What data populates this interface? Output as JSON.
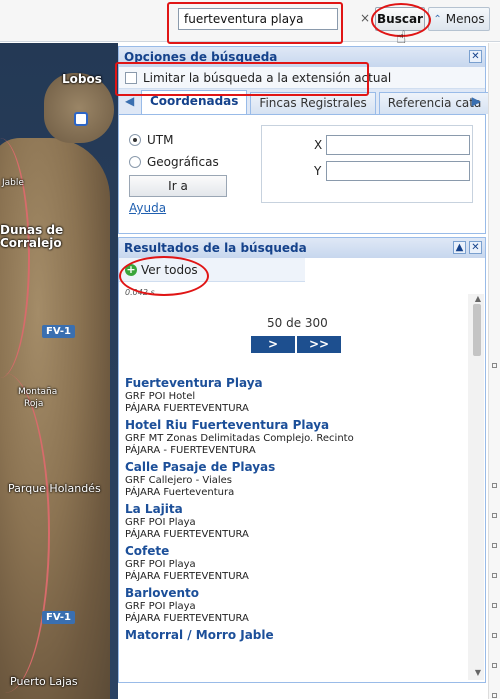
{
  "search": {
    "value": "fuerteventura playa",
    "clear": "×"
  },
  "toolbar": {
    "buscar_label": "Buscar",
    "menos_label": "Menos",
    "menos_icon": "double-chevron-up-icon"
  },
  "map": {
    "labels": {
      "lobos": "Lobos",
      "jable": "Jable",
      "dunas": "Dunas de",
      "corralejo": "Corralejo",
      "fv1_top": "FV-1",
      "montana": "Montaña",
      "roja": "Roja",
      "parque": "Parque Holandés",
      "fv1_bottom": "FV-1",
      "puerto": "Puerto Lajas"
    }
  },
  "options": {
    "title": "Opciones de búsqueda",
    "limit_label": "Limitar la búsqueda a la extensión actual",
    "tabs": [
      "Coordenadas",
      "Fincas Registrales",
      "Referencia cata"
    ],
    "radio_utm": "UTM",
    "radio_geo": "Geográficas",
    "ira_label": "Ir a",
    "ayuda_label": "Ayuda",
    "x_label": "X",
    "y_label": "Y"
  },
  "results": {
    "title": "Resultados de la búsqueda",
    "ver_todos": "Ver todos",
    "scale_text": "0.042 s",
    "pager_text": "50 de 300",
    "next_label": ">",
    "last_label": ">>",
    "items": [
      {
        "title": "Fuerteventura Playa",
        "line1": "GRF POI Hotel",
        "line2": "PÁJARA FUERTEVENTURA"
      },
      {
        "title": "Hotel Riu Fuerteventura Playa",
        "line1": "GRF MT Zonas Delimitadas Complejo. Recinto",
        "line2": "PÁJARA - FUERTEVENTURA"
      },
      {
        "title": "Calle Pasaje de Playas",
        "line1": "GRF Callejero - Viales",
        "line2": "PÁJARA Fuerteventura"
      },
      {
        "title": "La Lajita",
        "line1": "GRF POI Playa",
        "line2": "PÁJARA FUERTEVENTURA"
      },
      {
        "title": "Cofete",
        "line1": "GRF POI Playa",
        "line2": "PÁJARA FUERTEVENTURA"
      },
      {
        "title": "Barlovento",
        "line1": "GRF POI Playa",
        "line2": "PÁJARA FUERTEVENTURA"
      },
      {
        "title": "Matorral / Morro Jable",
        "line1": "",
        "line2": ""
      }
    ]
  },
  "colors": {
    "highlight": "#e01515",
    "link": "#1c4f99",
    "panel_border": "#99bbe8"
  }
}
